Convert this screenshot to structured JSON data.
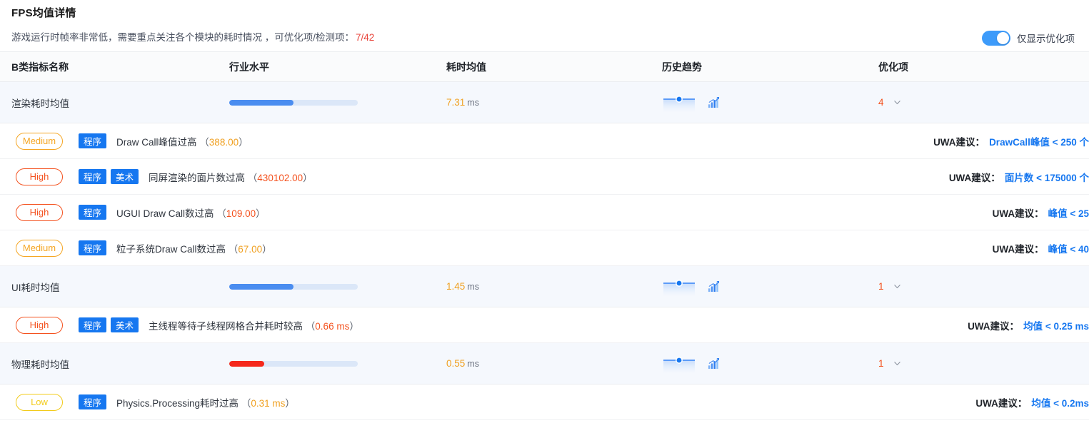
{
  "header": {
    "title": "FPS均值详情",
    "subtitle_text": "游戏运行时帧率非常低，需要重点关注各个模块的耗时情况 ，可优化项/检测项：",
    "subtitle_count": "7/42",
    "toggle_label": "仅显示优化项",
    "toggle_on": true,
    "accent_blue": "#1677f0",
    "count_red": "#e8453c"
  },
  "table": {
    "columns": [
      {
        "key": "name",
        "label": "B类指标名称"
      },
      {
        "key": "level",
        "label": "行业水平"
      },
      {
        "key": "avg",
        "label": "耗时均值"
      },
      {
        "key": "trend",
        "label": "历史趋势"
      },
      {
        "key": "opt",
        "label": "优化项"
      }
    ],
    "groups": [
      {
        "metric": {
          "name": "渲染耗时均值",
          "bar_percent": 50,
          "bar_color": "#4a8df0",
          "avg_value": "7.31",
          "avg_unit": "ms",
          "opt_count": "4",
          "trend_icon": "bar-chart-icon",
          "chevron": "chevron-down-icon"
        },
        "issues": [
          {
            "severity": "Medium",
            "severity_class": "sev-medium",
            "tags": [
              "程序"
            ],
            "title": "Draw Call峰值过高",
            "value": "388.00",
            "value_class": "issue-val",
            "advice_label": "UWA建议：",
            "advice_value": "DrawCall峰值 < 250 个"
          },
          {
            "severity": "High",
            "severity_class": "sev-high",
            "tags": [
              "程序",
              "美术"
            ],
            "title": "同屏渲染的面片数过高",
            "value": "430102.00",
            "value_class": "issue-val hi",
            "advice_label": "UWA建议：",
            "advice_value": "面片数 < 175000 个"
          },
          {
            "severity": "High",
            "severity_class": "sev-high",
            "tags": [
              "程序"
            ],
            "title": "UGUI Draw Call数过高",
            "value": "109.00",
            "value_class": "issue-val hi",
            "advice_label": "UWA建议：",
            "advice_value": "峰值 < 25"
          },
          {
            "severity": "Medium",
            "severity_class": "sev-medium",
            "tags": [
              "程序"
            ],
            "title": "粒子系统Draw Call数过高",
            "value": "67.00",
            "value_class": "issue-val",
            "advice_label": "UWA建议：",
            "advice_value": "峰值 < 40"
          }
        ]
      },
      {
        "metric": {
          "name": "UI耗时均值",
          "bar_percent": 50,
          "bar_color": "#4a8df0",
          "avg_value": "1.45",
          "avg_unit": "ms",
          "opt_count": "1",
          "trend_icon": "bar-chart-icon",
          "chevron": "chevron-down-icon"
        },
        "issues": [
          {
            "severity": "High",
            "severity_class": "sev-high",
            "tags": [
              "程序",
              "美术"
            ],
            "title": "主线程等待子线程网格合并耗时较高",
            "value": "0.66 ms",
            "value_class": "issue-val hi",
            "advice_label": "UWA建议：",
            "advice_value": "均值 < 0.25 ms"
          }
        ]
      },
      {
        "metric": {
          "name": "物理耗时均值",
          "bar_percent": 27,
          "bar_color": "#f5291c",
          "avg_value": "0.55",
          "avg_unit": "ms",
          "opt_count": "1",
          "trend_icon": "bar-chart-icon",
          "chevron": "chevron-down-icon"
        },
        "issues": [
          {
            "severity": "Low",
            "severity_class": "sev-low",
            "tags": [
              "程序"
            ],
            "title": "Physics.Processing耗时过高",
            "value": "0.31 ms",
            "value_class": "issue-val",
            "advice_label": "UWA建议：",
            "advice_value": "均值 < 0.2ms"
          }
        ]
      }
    ]
  }
}
